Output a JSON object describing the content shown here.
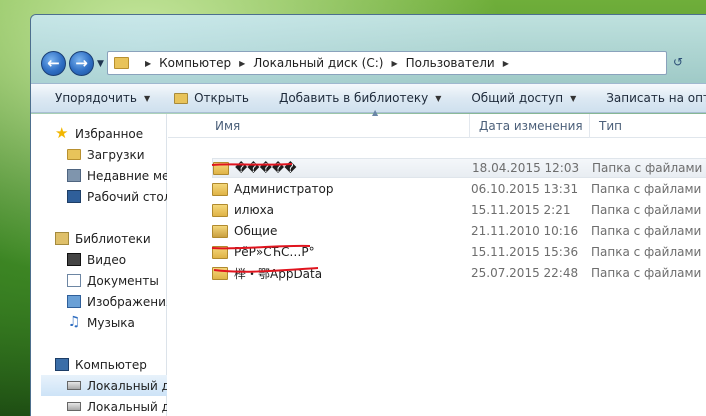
{
  "window": {
    "address": {
      "crumbs": [
        "Компьютер",
        "Локальный диск (C:)",
        "Пользователи"
      ]
    }
  },
  "toolbar": {
    "organize": "Упорядочить",
    "open": "Открыть",
    "add_library": "Добавить в библиотеку",
    "share": "Общий доступ",
    "burn": "Записать на оптический ди"
  },
  "sidebar": {
    "favorites": "Избранное",
    "downloads": "Загрузки",
    "recent": "Недавние места",
    "desktop": "Рабочий стол",
    "libraries": "Библиотеки",
    "video": "Видео",
    "documents": "Документы",
    "pictures": "Изображения",
    "music": "Музыка",
    "computer": "Компьютер",
    "drive_c": "Локальный диск (C",
    "drive_d": "Локальный диск (D"
  },
  "columns": {
    "name": "Имя",
    "date": "Дата изменения",
    "type": "Тип"
  },
  "files": [
    {
      "name": "�����",
      "date": "18.04.2015 12:03",
      "type": "Папка с файлами"
    },
    {
      "name": "Администратор",
      "date": "06.10.2015 13:31",
      "type": "Папка с файлами"
    },
    {
      "name": "илюха",
      "date": "15.11.2015 2:21",
      "type": "Папка с файлами"
    },
    {
      "name": "Общие",
      "date": "21.11.2010 10:16",
      "type": "Папка с файлами"
    },
    {
      "name": "РёР»СЋС…Р°",
      "date": "15.11.2015 15:36",
      "type": "Папка с файлами"
    },
    {
      "name": "榉・鄂AppData",
      "date": "25.07.2015 22:48",
      "type": "Папка с файлами"
    }
  ],
  "colors": {
    "annotation": "#e0141e",
    "toolbar_bg": "#dde9f3",
    "selection": "#cde3f7"
  }
}
